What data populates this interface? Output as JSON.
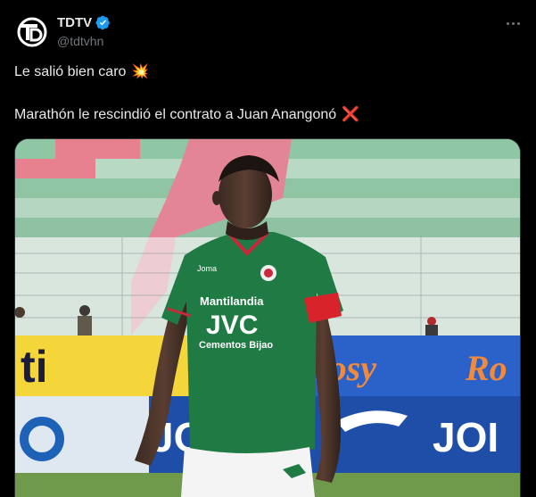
{
  "author": {
    "display_name": "TDTV",
    "handle": "@tdtvhn",
    "avatar_icon": "tdtv-logo-icon",
    "verified_icon": "verified-badge-icon",
    "verified_color": "#1d9bf0"
  },
  "more_icon": "more-options-icon",
  "tweet": {
    "line1": "Le salió bien caro",
    "line1_emoji": "💥",
    "line2": "Marathón le rescindió el contrato a Juan Anangonó",
    "line2_emoji": "❌"
  },
  "photo": {
    "jersey_sponsor_top": "Mantilandia",
    "jersey_sponsor_main": "JVC",
    "jersey_sponsor_bottom": "Cementos Bijao",
    "jersey_brand": "Joma",
    "board_left": "ti",
    "board_right_a": "Rosy",
    "board_right_b": "Ro",
    "board_bottom_a": "JO",
    "board_bottom_b": "JOI",
    "jersey_color": "#1f7a43",
    "armband_color": "#d8232a"
  }
}
